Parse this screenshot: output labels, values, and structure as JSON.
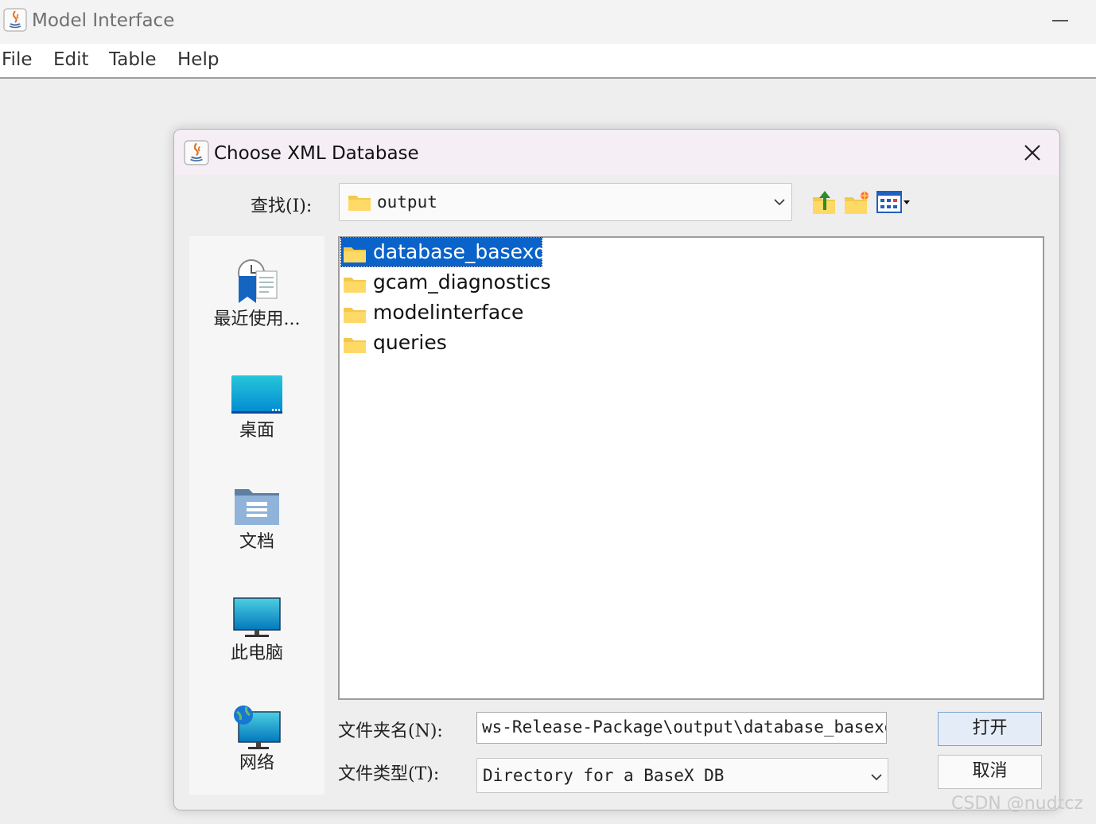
{
  "app": {
    "title": "Model Interface",
    "icon": "java-icon"
  },
  "menubar": {
    "items": [
      "File",
      "Edit",
      "Table",
      "Help"
    ]
  },
  "dialog": {
    "title": "Choose XML Database",
    "icon": "java-icon",
    "look_in": {
      "label": "查找(I):",
      "value": "output"
    },
    "toolbar": {
      "up_folder": "up-one-level-icon",
      "new_folder": "create-new-folder-icon",
      "view_menu": "view-menu-icon"
    },
    "places": [
      {
        "label": "最近使用...",
        "icon": "recent-items-icon"
      },
      {
        "label": "桌面",
        "icon": "desktop-icon"
      },
      {
        "label": "文档",
        "icon": "documents-icon"
      },
      {
        "label": "此电脑",
        "icon": "this-pc-icon"
      },
      {
        "label": "网络",
        "icon": "network-icon"
      }
    ],
    "files": [
      {
        "name": "database_basexdb",
        "selected": true
      },
      {
        "name": "gcam_diagnostics",
        "selected": false
      },
      {
        "name": "modelinterface",
        "selected": false
      },
      {
        "name": "queries",
        "selected": false
      }
    ],
    "filename": {
      "label": "文件夹名(N):",
      "value": "ws-Release-Package\\output\\database_basexdb"
    },
    "filetype": {
      "label": "文件类型(T):",
      "value": "Directory for a BaseX DB"
    },
    "buttons": {
      "open": "打开",
      "cancel": "取消"
    }
  },
  "watermark": "CSDN @nudtcz",
  "colors": {
    "selection": "#0a63c9",
    "open_button_bg": "#e4edf7",
    "dialog_title_bg": "#f6eef5"
  }
}
